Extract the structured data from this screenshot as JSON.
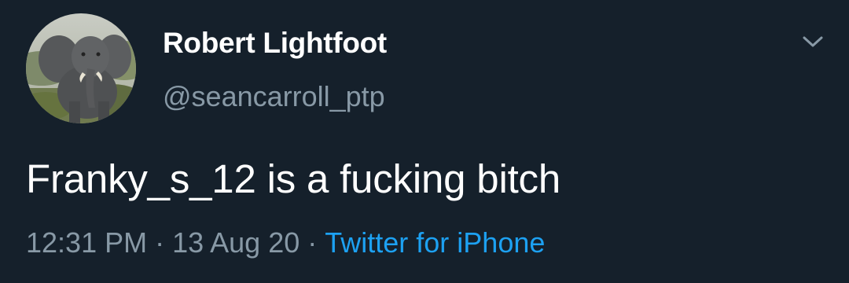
{
  "user": {
    "display_name": "Robert Lightfoot",
    "handle": "@seancarroll_ptp",
    "avatar_icon": "elephant-avatar"
  },
  "tweet": {
    "text": "Franky_s_12 is a fucking bitch",
    "time": "12:31 PM",
    "date": "13 Aug 20",
    "separator": "·",
    "source": "Twitter for iPhone"
  },
  "menu": {
    "icon": "chevron-down-icon"
  },
  "colors": {
    "background": "#15202b",
    "primary_text": "#ffffff",
    "secondary_text": "#8899a6",
    "link": "#1da1f2"
  }
}
